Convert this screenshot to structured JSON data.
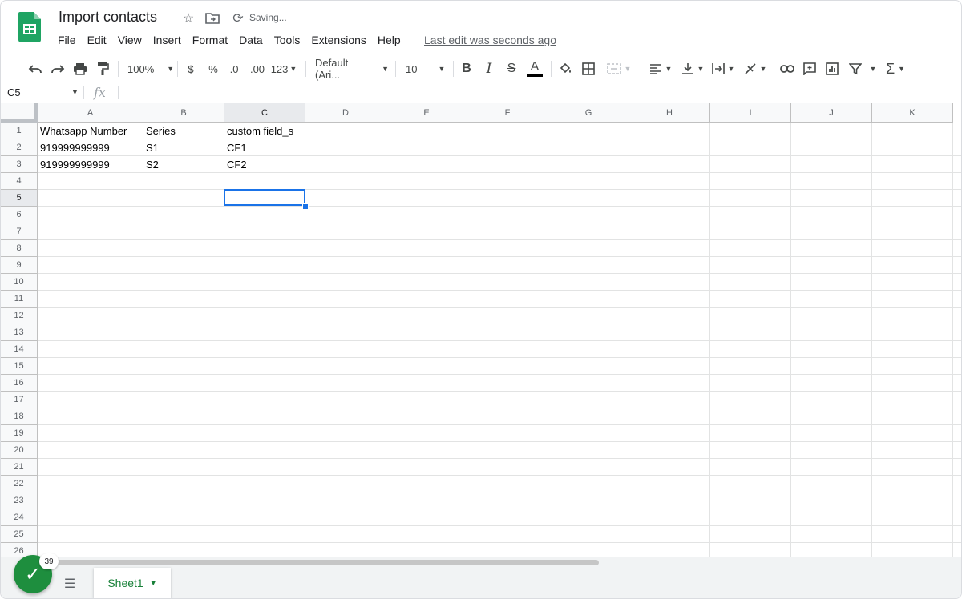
{
  "doc": {
    "title": "Import contacts",
    "saving": "Saving...",
    "last_edit": "Last edit was seconds ago",
    "brand_color": "#188038"
  },
  "menu": [
    "File",
    "Edit",
    "View",
    "Insert",
    "Format",
    "Data",
    "Tools",
    "Extensions",
    "Help"
  ],
  "toolbar": {
    "zoom": "100%",
    "currency": "$",
    "percent": "%",
    "dec_decrease": ".0",
    "dec_increase": ".00",
    "more_formats": "123",
    "font": "Default (Ari...",
    "font_size": "10",
    "bold": "B",
    "italic": "I",
    "strike": "S",
    "text_color_glyph": "A",
    "sum_glyph": "Σ"
  },
  "formula_bar": {
    "cell_ref": "C5",
    "fx": "fx",
    "value": ""
  },
  "columns": [
    "A",
    "B",
    "C",
    "D",
    "E",
    "F",
    "G",
    "H",
    "I",
    "J",
    "K"
  ],
  "rows": [
    "1",
    "2",
    "3",
    "4",
    "5",
    "6",
    "7",
    "8",
    "9",
    "10",
    "11",
    "12",
    "13",
    "14",
    "15",
    "16",
    "17",
    "18",
    "19",
    "20",
    "21",
    "22",
    "23",
    "24",
    "25",
    "26"
  ],
  "cells": [
    [
      "Whatsapp Number",
      "Series",
      "custom field_s"
    ],
    [
      "919999999999",
      "S1",
      "CF1"
    ],
    [
      "919999999999",
      "S2",
      "CF2"
    ]
  ],
  "selected_cell": "C5",
  "sheets": [
    {
      "name": "Sheet1",
      "active": true
    }
  ],
  "notifications_badge": "39"
}
